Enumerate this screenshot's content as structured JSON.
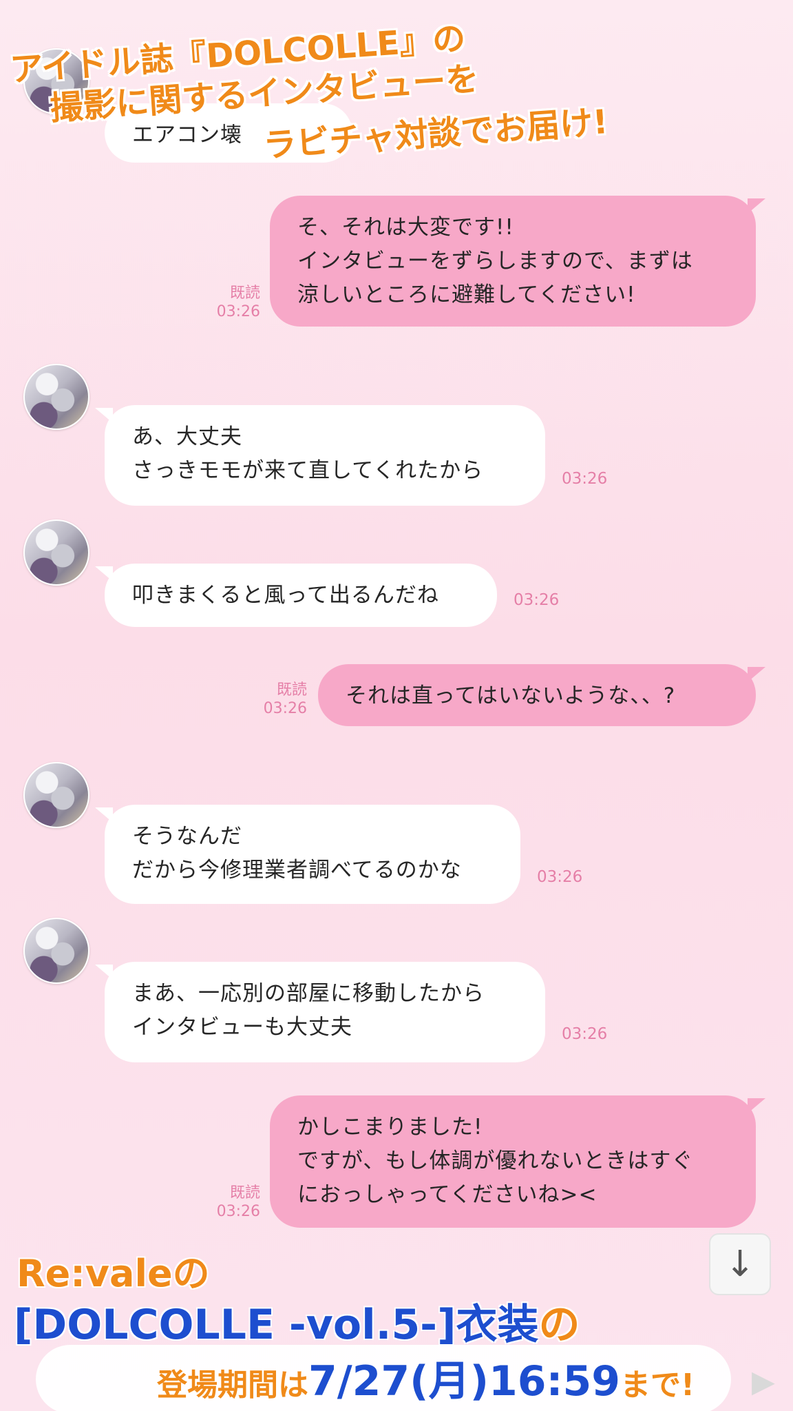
{
  "overlay": {
    "title_line1": "アイドル誌『DOLCOLLE』の",
    "title_line2": "撮影に関するインタビューを",
    "title_line3": "ラビチャ対談でお届け!"
  },
  "messages": [
    {
      "side": "left",
      "text": "エアコン壊",
      "time": ""
    },
    {
      "side": "right",
      "text": "そ、それは大変です!!\nインタビューをずらしますので、まずは\n涼しいところに避難してください!",
      "read": "既読",
      "time": "03:26"
    },
    {
      "side": "left",
      "text": "あ、大丈夫\nさっきモモが来て直してくれたから",
      "time": "03:26"
    },
    {
      "side": "left",
      "text": "叩きまくると風って出るんだね",
      "time": "03:26"
    },
    {
      "side": "right",
      "text": "それは直ってはいないような、、?",
      "read": "既読",
      "time": "03:26"
    },
    {
      "side": "left",
      "text": "そうなんだ\nだから今修理業者調べてるのかな",
      "time": "03:26"
    },
    {
      "side": "left",
      "text": "まあ、一応別の部屋に移動したから\nインタビューも大丈夫",
      "time": "03:26"
    },
    {
      "side": "right",
      "text": "かしこまりました!\nですが、もし体調が優れないときはすぐ\nにおっしゃってくださいね><",
      "read": "既読",
      "time": "03:26"
    }
  ],
  "banner": {
    "line1_a": "Re:vale",
    "line1_b": "の",
    "line2_a": "[DOLCOLLE -vol.5-]衣装",
    "line2_b": "の",
    "line3_a": "登場期間は",
    "line3_b": "7/27(月)16:59",
    "line3_c": "まで!"
  },
  "icons": {
    "scroll_down": "arrow-down-icon",
    "send": "send-icon"
  },
  "colors": {
    "accent_orange": "#f08a19",
    "accent_blue": "#1d4ecf",
    "bubble_right": "#f7a8c8",
    "meta_pink": "#e57fa7"
  }
}
